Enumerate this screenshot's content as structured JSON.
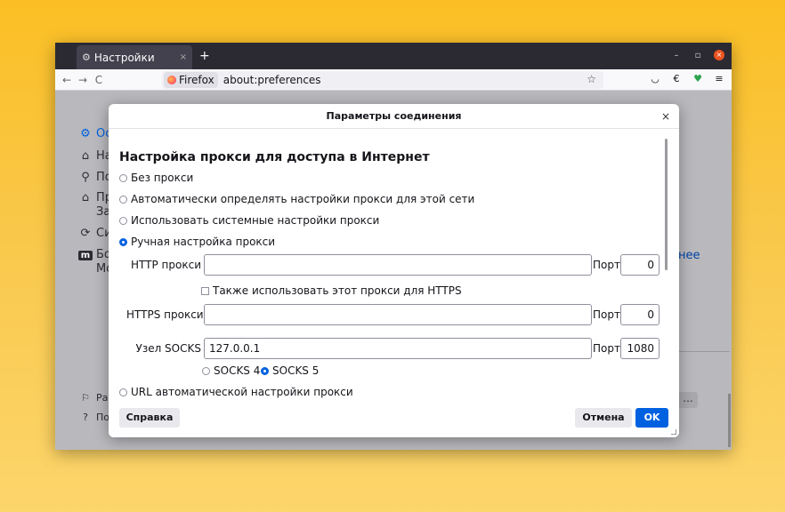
{
  "tab": {
    "title": "Настройки",
    "close": "×",
    "icon": "gear-icon"
  },
  "newtab": "+",
  "window_controls": {
    "minimize": "–",
    "maximize": "▫",
    "close": "×"
  },
  "nav": {
    "back": "←",
    "forward": "→",
    "reload": "C"
  },
  "urlbar": {
    "identity": "Firefox",
    "url": "about:preferences",
    "star": "☆"
  },
  "toolbar_icons": {
    "pocket": "◡",
    "ext1": "€",
    "shield": "♥",
    "menu": "≡"
  },
  "background": {
    "side_items": [
      {
        "icon": "⚙",
        "label": "Ос"
      },
      {
        "icon": "⌂",
        "label": "На"
      },
      {
        "icon": "⚲",
        "label": "По"
      },
      {
        "icon": "⌂",
        "label": "Пр"
      },
      {
        "icon": "",
        "label": "За"
      },
      {
        "icon": "⟳",
        "label": "Си"
      },
      {
        "icon": "m",
        "label": "Бо"
      },
      {
        "icon": "",
        "label": "Mo"
      }
    ],
    "bottom_items": [
      {
        "icon": "⚐",
        "label": "Ра"
      },
      {
        "icon": "?",
        "label": "По"
      }
    ],
    "link": "нее",
    "dots": "..."
  },
  "dialog": {
    "title": "Параметры соединения",
    "close": "×",
    "heading": "Настройка прокси для доступа в Интернет",
    "options": [
      {
        "label": "Без прокси",
        "selected": false
      },
      {
        "label": "Автоматически определять настройки прокси для этой сети",
        "selected": false
      },
      {
        "label": "Использовать системные настройки прокси",
        "selected": false
      },
      {
        "label": "Ручная настройка прокси",
        "selected": true
      }
    ],
    "http": {
      "label": "HTTP прокси",
      "value": "",
      "port_label": "Порт",
      "port": "0"
    },
    "also_https": "Также использовать этот прокси для HTTPS",
    "https": {
      "label": "HTTPS прокси",
      "value": "",
      "port_label": "Порт",
      "port": "0"
    },
    "socks": {
      "label": "Узел SOCKS",
      "value": "127.0.0.1",
      "port_label": "Порт",
      "port": "1080"
    },
    "socks4": "SOCKS 4",
    "socks5": "SOCKS 5",
    "auto_url": "URL автоматической настройки прокси",
    "help_button": "Справка",
    "cancel_button": "Отмена",
    "ok_button": "OK"
  }
}
